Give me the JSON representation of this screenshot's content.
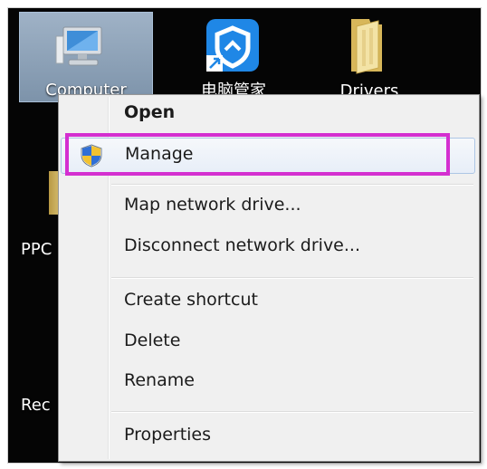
{
  "desktop": {
    "icons": [
      {
        "label": "Computer",
        "icon": "computer-icon"
      },
      {
        "label": "电脑管家",
        "icon": "shield-app-icon"
      },
      {
        "label": "Drivers",
        "icon": "folder-icon"
      }
    ],
    "side_labels": [
      "PPC",
      "Rec"
    ]
  },
  "context_menu": {
    "items": [
      {
        "label": "Open",
        "default": true
      },
      {
        "label": "Manage",
        "icon": "uac-shield-icon",
        "highlighted": true
      },
      {
        "label": "Map network drive..."
      },
      {
        "label": "Disconnect network drive..."
      },
      {
        "label": "Create shortcut"
      },
      {
        "label": "Delete"
      },
      {
        "label": "Rename"
      },
      {
        "label": "Properties"
      }
    ]
  },
  "colors": {
    "highlight_border": "#d42fd0",
    "desktop_background": "#050505",
    "menu_background": "#f0f0f0"
  }
}
